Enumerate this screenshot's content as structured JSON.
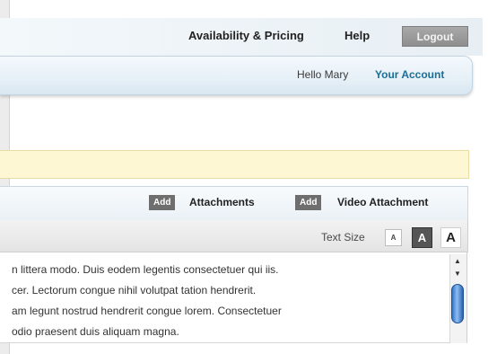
{
  "topnav": {
    "availability_label": "Availability & Pricing",
    "help_label": "Help",
    "logout_label": "Logout"
  },
  "account": {
    "greeting": "Hello Mary",
    "account_link": "Your Account"
  },
  "toolbar": {
    "add_label_1": "Add",
    "attachments_label": "Attachments",
    "add_label_2": "Add",
    "video_attachment_label": "Video Attachment"
  },
  "text_size": {
    "label": "Text Size",
    "small": "A",
    "medium": "A",
    "large": "A",
    "selected": "medium"
  },
  "content": {
    "lines": [
      "n littera modo. Duis eodem legentis consectetuer qui iis.",
      "cer. Lectorum congue nihil volutpat tation hendrerit.",
      "am legunt nostrud hendrerit congue lorem. Consectetuer",
      "odio praesent duis aliquam magna."
    ]
  },
  "scrollbar": {
    "up_icon": "scroll-up-arrow",
    "down_icon": "scroll-down-arrow",
    "thumb_color": "#3a7bd0"
  },
  "colors": {
    "account_link": "#1c6f95",
    "notice_bar": "#fdf7d3",
    "logout_button": "#9b9b9b",
    "add_button": "#6e6e6e"
  }
}
